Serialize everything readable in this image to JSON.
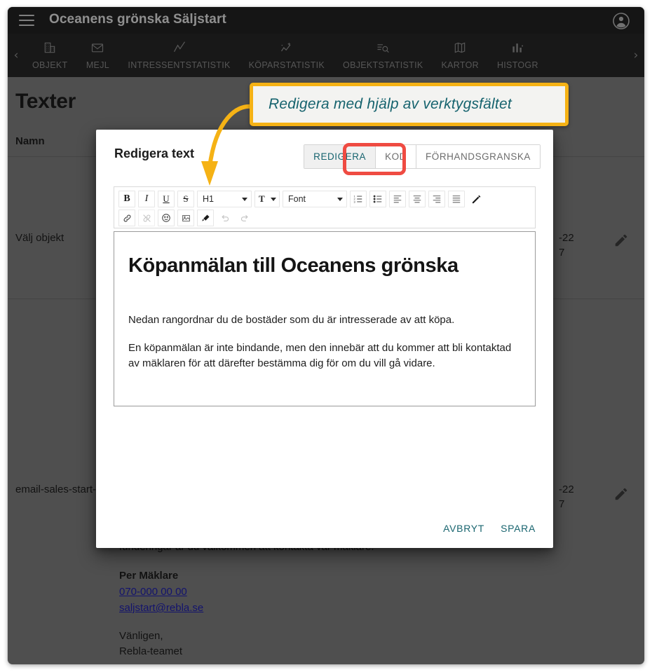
{
  "appbar": {
    "menu_icon": "hamburger-icon",
    "title": "Oceanens grönska Säljstart",
    "avatar_icon": "account-circle-icon"
  },
  "tabstrip": {
    "scroll_left_icon": "chevron-left-icon",
    "scroll_right_icon": "chevron-right-icon",
    "tabs": [
      {
        "label": "OBJEKT",
        "icon": "building-icon"
      },
      {
        "label": "MEJL",
        "icon": "envelope-icon"
      },
      {
        "label": "INTRESSENTSTATISTIK",
        "icon": "line-chart-icon"
      },
      {
        "label": "KÖPARSTATISTIK",
        "icon": "sparkline-star-icon"
      },
      {
        "label": "OBJEKTSTATISTIK",
        "icon": "list-search-icon"
      },
      {
        "label": "KARTOR",
        "icon": "map-icon"
      },
      {
        "label": "HISTOGR",
        "icon": "bar-chart-icon"
      }
    ]
  },
  "page": {
    "title": "Texter",
    "column_header": "Namn",
    "rows": [
      {
        "name": "Välj objekt",
        "date": "-22\n7",
        "edit_icon": "pencil-icon"
      },
      {
        "name": "email-sales-start-signup",
        "date": "-22\n7",
        "edit_icon": "pencil-icon"
      }
    ],
    "mail_preview": {
      "line_occluded": "funderingar är du välkommen att kontakta var mäklare.",
      "broker_name": "Per Mäklare",
      "phone": "070-000 00 00",
      "email": "saljstart@rebla.se",
      "closing_1": "Vänligen,",
      "closing_2": "Rebla-teamet"
    }
  },
  "dialog": {
    "title": "Redigera text",
    "tabs": [
      {
        "label": "REDIGERA",
        "active": true
      },
      {
        "label": "KOD",
        "active": false
      },
      {
        "label": "FÖRHANDSGRANSKA",
        "active": false
      }
    ],
    "toolbar": {
      "row1": [
        {
          "name": "bold-icon",
          "glyph": "B",
          "style": "bold-serif",
          "disabled": false
        },
        {
          "name": "italic-icon",
          "glyph": "I",
          "style": "italic-serif",
          "disabled": false
        },
        {
          "name": "underline-icon",
          "glyph": "U",
          "style": "underline-serif",
          "disabled": false
        },
        {
          "name": "strikethrough-icon",
          "glyph": "S",
          "style": "strike-serif",
          "disabled": false
        }
      ],
      "heading_select": {
        "value": "H1",
        "caret_icon": "chevron-down-icon"
      },
      "text_color": {
        "glyph": "T",
        "caret_icon": "chevron-down-icon",
        "name": "text-color-icon"
      },
      "font_select": {
        "value": "Font",
        "caret_icon": "chevron-down-icon"
      },
      "row1_right": [
        {
          "name": "ordered-list-icon",
          "glyph": "ol"
        },
        {
          "name": "unordered-list-icon",
          "glyph": "ul"
        },
        {
          "name": "align-left-icon",
          "glyph": "al"
        },
        {
          "name": "align-center-icon",
          "glyph": "ac"
        },
        {
          "name": "align-right-icon",
          "glyph": "ar"
        },
        {
          "name": "align-justify-icon",
          "glyph": "aj"
        },
        {
          "name": "pen-icon",
          "glyph": "pen"
        }
      ],
      "row2": [
        {
          "name": "insert-link-icon",
          "glyph": "link",
          "disabled": false
        },
        {
          "name": "remove-link-icon",
          "glyph": "unlink",
          "disabled": true
        },
        {
          "name": "emoji-icon",
          "glyph": "emoji",
          "disabled": false
        },
        {
          "name": "insert-image-icon",
          "glyph": "image",
          "disabled": false
        },
        {
          "name": "clear-format-icon",
          "glyph": "eraser",
          "disabled": false
        },
        {
          "name": "undo-icon",
          "glyph": "undo",
          "disabled": true
        },
        {
          "name": "redo-icon",
          "glyph": "redo",
          "disabled": true
        }
      ]
    },
    "editor": {
      "heading": "Köpanmälan till Oceanens grönska",
      "paragraph_1": "Nedan rangordnar du de bostäder som du är intresserade av att köpa.",
      "paragraph_2": "En köpanmälan är inte bindande, men den innebär att du kommer att bli kontaktad av mäklaren för att därefter bestämma dig för om du vill gå vidare."
    },
    "actions": {
      "cancel": "AVBRYT",
      "save": "SPARA"
    }
  },
  "annotation": {
    "callout_text": "Redigera med hjälp av verktygsfältet",
    "callout_border_color": "#f5b215",
    "callout_bg_color": "#f3f3f1",
    "callout_text_color": "#16636e",
    "arrow_color": "#f5b215",
    "highlight_ring_color": "#ef4b42"
  }
}
